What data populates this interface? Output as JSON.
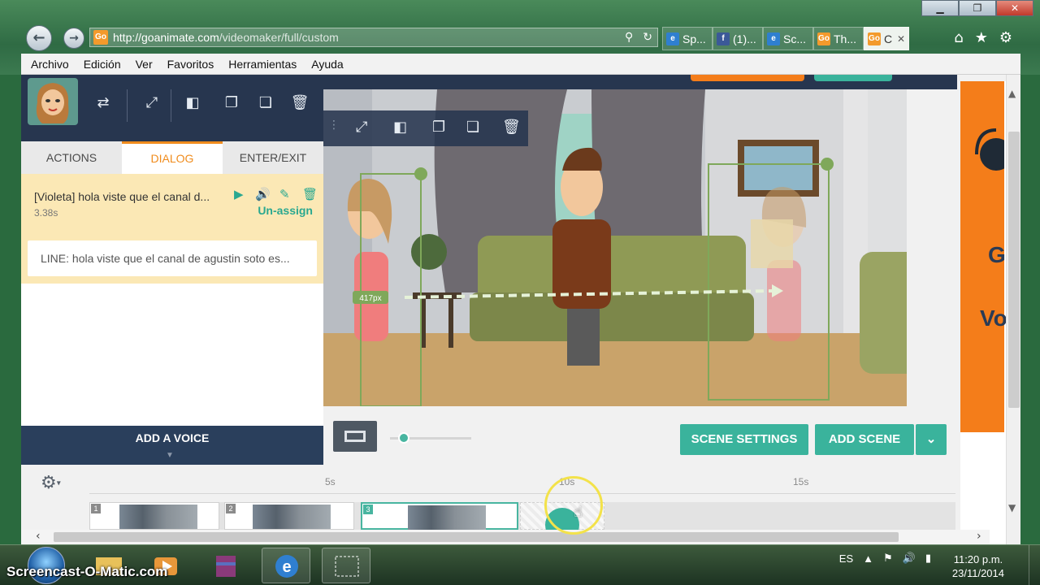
{
  "window": {
    "minimize": "▁",
    "maximize": "❐",
    "close": "✕"
  },
  "browser": {
    "url_host": "http://goanimate.com",
    "url_path": "/videomaker/full/custom",
    "favicon_text": "Go",
    "tabs": [
      {
        "icon": "ie-icon",
        "label": "Sp..."
      },
      {
        "icon": "facebook-icon",
        "label": "(1)..."
      },
      {
        "icon": "ie-icon",
        "label": "Sc..."
      },
      {
        "icon": "goanimate-icon",
        "label": "Th..."
      },
      {
        "icon": "goanimate-icon",
        "label": "C",
        "active": true
      }
    ],
    "tab_close": "✕"
  },
  "menu": [
    "Archivo",
    "Edición",
    "Ver",
    "Favoritos",
    "Herramientas",
    "Ayuda"
  ],
  "panel": {
    "tabs": [
      "ACTIONS",
      "DIALOG",
      "ENTER/EXIT"
    ],
    "active_tab": "DIALOG",
    "dialog": {
      "title": "[Violeta] hola viste que el canal d...",
      "duration": "3.38s",
      "unassign": "Un-assign",
      "line": "LINE: hola viste que el canal de agustin soto es..."
    },
    "add_voice": "ADD A VOICE"
  },
  "stage": {
    "distance_label": "417px"
  },
  "controls": {
    "scene_settings": "SCENE SETTINGS",
    "add_scene": "ADD SCENE"
  },
  "timeline": {
    "ticks": [
      "5s",
      "10s",
      "15s"
    ],
    "scenes": [
      "1",
      "2",
      "3"
    ]
  },
  "ad": {
    "letters": [
      "G",
      "Vo"
    ]
  },
  "taskbar": {
    "lang": "ES",
    "time": "11:20 p.m.",
    "date": "23/11/2014"
  },
  "watermark": "Screencast-O-Matic.com",
  "colors": {
    "accent_orange": "#f08c1d",
    "teal": "#3ab39c",
    "navy": "#27364f"
  }
}
